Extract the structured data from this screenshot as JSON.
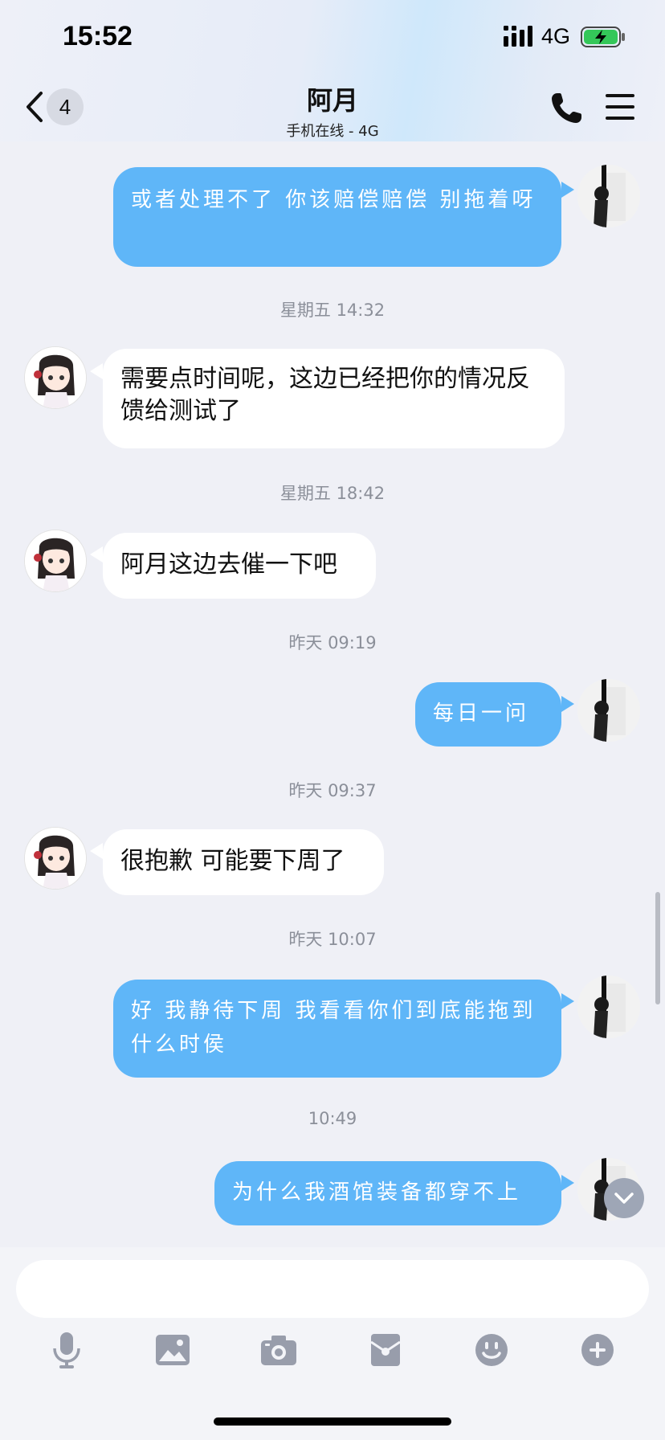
{
  "status_bar": {
    "time": "15:52",
    "network": "4G"
  },
  "header": {
    "unread_count": "4",
    "title": "阿月",
    "subtitle": "手机在线 - 4G"
  },
  "messages": [
    {
      "from": "me",
      "text": "或者处理不了 你该赔偿赔偿 别拖着呀"
    },
    {
      "timestamp": "星期五 14:32"
    },
    {
      "from": "peer",
      "text": "需要点时间呢，这边已经把你的情况反馈给测试了"
    },
    {
      "timestamp": "星期五 18:42"
    },
    {
      "from": "peer",
      "text": "阿月这边去催一下吧"
    },
    {
      "timestamp": "昨天 09:19"
    },
    {
      "from": "me",
      "text": "每日一问"
    },
    {
      "timestamp": "昨天 09:37"
    },
    {
      "from": "peer",
      "text": "很抱歉 可能要下周了"
    },
    {
      "timestamp": "昨天 10:07"
    },
    {
      "from": "me",
      "text": "好 我静待下周 我看看你们到底能拖到什么时侯"
    },
    {
      "timestamp": "10:49"
    },
    {
      "from": "me",
      "text": "为什么我酒馆装备都穿不上"
    }
  ],
  "toolbar": [
    "mic-icon",
    "image-icon",
    "camera-icon",
    "red-packet-icon",
    "emoji-icon",
    "plus-icon"
  ],
  "colors": {
    "my_bubble": "#5fb6f8",
    "peer_bubble": "#ffffff",
    "background": "#eff0f6"
  }
}
